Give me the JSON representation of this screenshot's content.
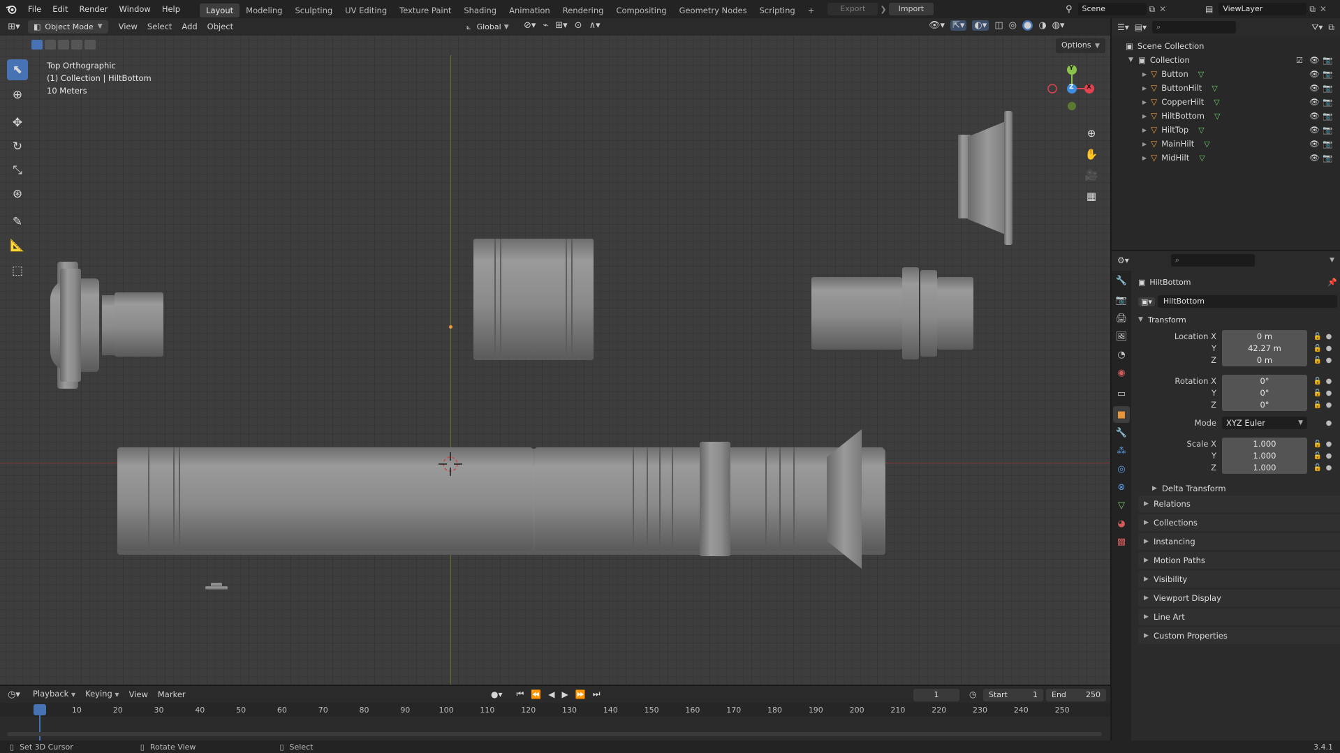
{
  "topbar": {
    "menu": [
      "File",
      "Edit",
      "Render",
      "Window",
      "Help"
    ],
    "workspaces": [
      "Layout",
      "Modeling",
      "Sculpting",
      "UV Editing",
      "Texture Paint",
      "Shading",
      "Animation",
      "Rendering",
      "Compositing",
      "Geometry Nodes",
      "Scripting"
    ],
    "active_workspace": "Layout",
    "add_workspace": "+",
    "export_label": "Export",
    "import_label": "Import",
    "scene_name": "Scene",
    "view_layer": "ViewLayer"
  },
  "viewport_header": {
    "mode": "Object Mode",
    "menus": [
      "View",
      "Select",
      "Add",
      "Object"
    ],
    "orientation": "Global",
    "options_label": "Options"
  },
  "viewport": {
    "view_name": "Top Orthographic",
    "collection_info": "(1) Collection | HiltBottom",
    "scale": "10 Meters",
    "gizmo": {
      "y": "Y",
      "z": "Z",
      "x": "X"
    }
  },
  "outliner": {
    "scene_collection": "Scene Collection",
    "collection": "Collection",
    "objects": [
      "Button",
      "ButtonHilt",
      "CopperHilt",
      "HiltBottom",
      "HiltTop",
      "MainHilt",
      "MidHilt"
    ],
    "selected": "HiltBottom"
  },
  "properties": {
    "object_name": "HiltBottom",
    "data_name": "HiltBottom",
    "transform_label": "Transform",
    "location_label": "Location X",
    "rotation_label": "Rotation X",
    "scale_label": "Scale X",
    "axis_y": "Y",
    "axis_z": "Z",
    "location": [
      "0 m",
      "42.27 m",
      "0 m"
    ],
    "rotation": [
      "0°",
      "0°",
      "0°"
    ],
    "mode_label": "Mode",
    "mode_value": "XYZ Euler",
    "scale": [
      "1.000",
      "1.000",
      "1.000"
    ],
    "panels": [
      "Delta Transform",
      "Relations",
      "Collections",
      "Instancing",
      "Motion Paths",
      "Visibility",
      "Viewport Display",
      "Line Art",
      "Custom Properties"
    ]
  },
  "timeline": {
    "menus": [
      "Playback",
      "Keying",
      "View",
      "Marker"
    ],
    "current_frame": "1",
    "start_label": "Start",
    "start": "1",
    "end_label": "End",
    "end": "250",
    "ticks": [
      "1",
      "10",
      "20",
      "30",
      "40",
      "50",
      "60",
      "70",
      "80",
      "90",
      "100",
      "110",
      "120",
      "130",
      "140",
      "150",
      "160",
      "170",
      "180",
      "190",
      "200",
      "210",
      "220",
      "230",
      "240",
      "250"
    ]
  },
  "statusbar": {
    "hint1": "Set 3D Cursor",
    "hint2": "Rotate View",
    "hint3": "Select",
    "version": "3.4.1"
  },
  "colors": {
    "accent": "#4772b3",
    "x_axis": "#e0424f",
    "y_axis": "#8bc34a",
    "z_axis": "#3f8de0",
    "object_icon": "#e8953a"
  }
}
